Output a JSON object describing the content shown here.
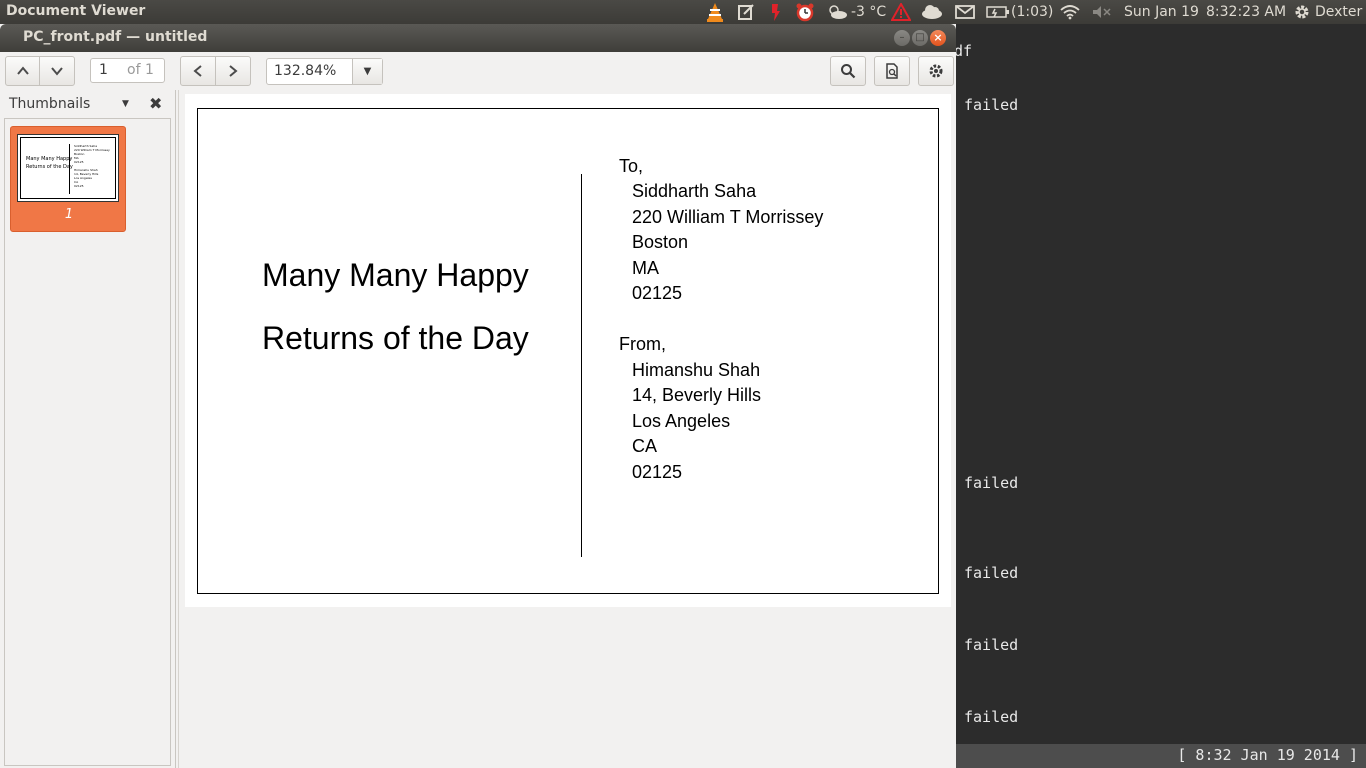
{
  "top_panel": {
    "app_name": "Document Viewer",
    "weather": "-3 °C",
    "battery": "(1:03)",
    "date": "Sun Jan 19",
    "time": "8:32:23 AM",
    "user": "Dexter",
    "icons": [
      "vlc-icon",
      "edit-icon",
      "torch-icon",
      "alarm-clock-icon",
      "weather-icon",
      "warning-icon",
      "cloud-icon",
      "mail-icon",
      "battery-icon",
      "wifi-icon",
      "volume-muted-icon",
      "gear-icon"
    ]
  },
  "window": {
    "title": "PC_front.pdf — untitled"
  },
  "toolbar": {
    "page_current": "1",
    "page_total": "of 1",
    "zoom": "132.84%"
  },
  "sidebar": {
    "label": "Thumbnails",
    "thumbnails": [
      {
        "number": "1"
      }
    ]
  },
  "document": {
    "greeting_line1": "Many Many Happy",
    "greeting_line2": "Returns of the Day",
    "to_label": "To,",
    "to_lines": [
      "Siddharth Saha",
      "220 William T Morrissey",
      "Boston",
      "MA",
      "02125"
    ],
    "from_label": "From,",
    "from_lines": [
      "Himanshu Shah",
      "14, Beverly Hills",
      "Los Angeles",
      "CA",
      "02125"
    ]
  },
  "terminal": {
    "top_fragment": "df",
    "lines": [
      "failed",
      "failed",
      "failed",
      "failed",
      "failed"
    ],
    "status": "[ 8:32 Jan 19 2014 ]"
  },
  "colors": {
    "accent": "#f07746",
    "panel": "#3c3b37",
    "window_bg": "#f2f1f0"
  }
}
